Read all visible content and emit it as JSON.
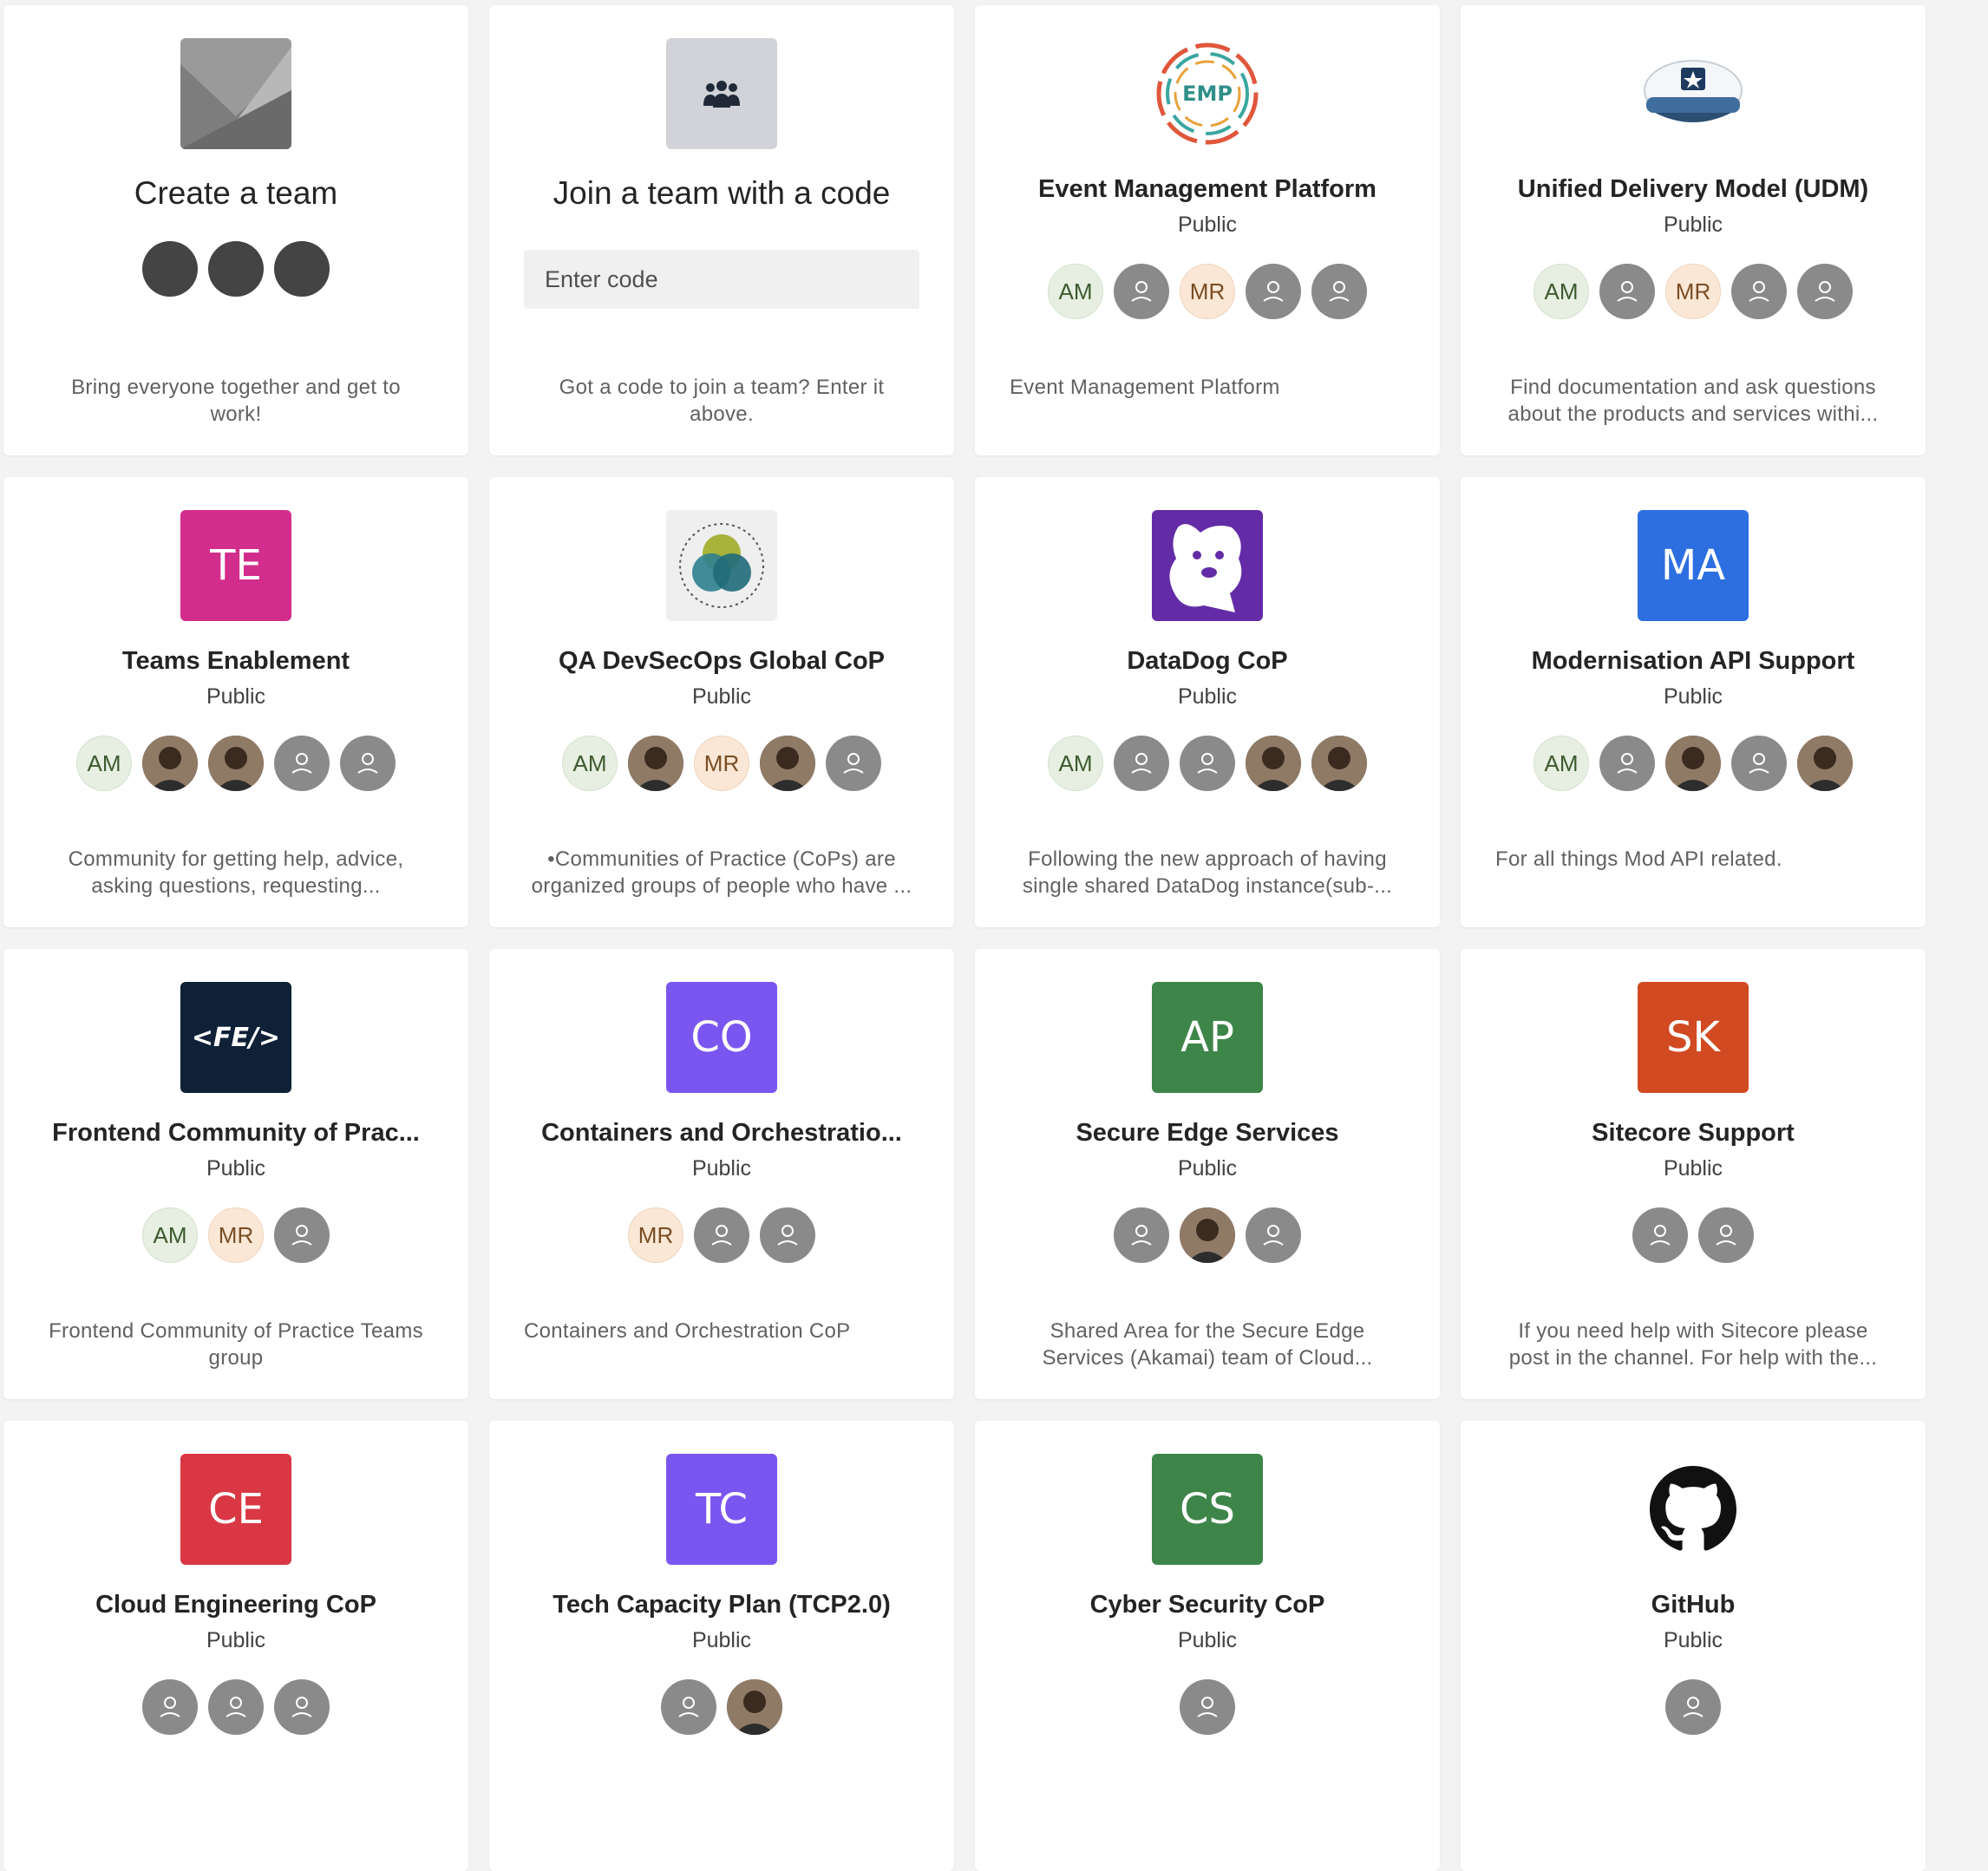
{
  "create_card": {
    "title": "Create a team",
    "description": "Bring everyone together and get to work!"
  },
  "join_card": {
    "title": "Join a team with a code",
    "placeholder": "Enter code",
    "description": "Got a code to join a team? Enter it above."
  },
  "teams": [
    {
      "name": "Event Management Platform",
      "visibility": "Public",
      "logo_type": "emp-logo-icon",
      "logo_text": "EMP",
      "members": [
        "AM",
        "generic",
        "MR",
        "generic",
        "generic"
      ],
      "description": "Event Management Platform",
      "align": "left"
    },
    {
      "name": "Unified Delivery Model (UDM)",
      "visibility": "Public",
      "logo_type": "captain-hat-icon",
      "logo_text": "",
      "members": [
        "AM",
        "generic",
        "MR",
        "generic",
        "generic"
      ],
      "description": "Find documentation and ask questions about the products and services withi...",
      "align": "center"
    },
    {
      "name": "Teams Enablement",
      "visibility": "Public",
      "logo_text": "TE",
      "logo_color": "#d22d8c",
      "members": [
        "AM",
        "photo",
        "photo",
        "generic",
        "generic"
      ],
      "description": "Community for getting help, advice, asking questions, requesting...",
      "align": "center"
    },
    {
      "name": "QA DevSecOps Global CoP",
      "visibility": "Public",
      "logo_type": "venn-diagram-icon",
      "logo_text": "",
      "members": [
        "AM",
        "photo",
        "MR",
        "photo",
        "generic"
      ],
      "description": "•Communities of Practice (CoPs) are organized groups of people who have ...",
      "align": "center"
    },
    {
      "name": "DataDog CoP",
      "visibility": "Public",
      "logo_type": "datadog-icon",
      "logo_text": "",
      "members": [
        "AM",
        "generic",
        "generic",
        "photo",
        "photo"
      ],
      "description": "Following the new approach of having single shared DataDog instance(sub-...",
      "align": "center"
    },
    {
      "name": "Modernisation API Support",
      "visibility": "Public",
      "logo_text": "MA",
      "logo_color": "#2d6fe0",
      "members": [
        "AM",
        "generic",
        "photo",
        "generic",
        "photo"
      ],
      "description": "For all things Mod API related.",
      "align": "left"
    },
    {
      "name": "Frontend Community of Prac...",
      "visibility": "Public",
      "logo_type": "fe-logo-icon",
      "logo_text": "<FE/>",
      "members": [
        "AM",
        "MR",
        "generic"
      ],
      "description": "Frontend Community of Practice Teams group",
      "align": "center"
    },
    {
      "name": "Containers and Orchestratio...",
      "visibility": "Public",
      "logo_text": "CO",
      "logo_color": "#7b55f0",
      "members": [
        "MR",
        "generic",
        "generic"
      ],
      "description": "Containers and Orchestration CoP",
      "align": "left"
    },
    {
      "name": "Secure Edge Services",
      "visibility": "Public",
      "logo_text": "AP",
      "logo_color": "#3e854a",
      "members": [
        "generic",
        "photo",
        "generic"
      ],
      "description": "Shared Area for the Secure Edge Services (Akamai) team of Cloud...",
      "align": "center"
    },
    {
      "name": "Sitecore Support",
      "visibility": "Public",
      "logo_text": "SK",
      "logo_color": "#d14a22",
      "members": [
        "generic",
        "generic"
      ],
      "description": "If you need help with Sitecore please post in the channel. For help with the...",
      "align": "center"
    },
    {
      "name": "Cloud Engineering CoP",
      "visibility": "Public",
      "logo_text": "CE",
      "logo_color": "#d93744",
      "members": [
        "generic",
        "generic",
        "generic"
      ],
      "description": "",
      "align": "center"
    },
    {
      "name": "Tech Capacity Plan (TCP2.0)",
      "visibility": "Public",
      "logo_text": "TC",
      "logo_color": "#7b55f0",
      "members": [
        "generic",
        "photo"
      ],
      "description": "",
      "align": "center"
    },
    {
      "name": "Cyber Security CoP",
      "visibility": "Public",
      "logo_text": "CS",
      "logo_color": "#3e854a",
      "members": [
        "generic"
      ],
      "description": "",
      "align": "center"
    },
    {
      "name": "GitHub",
      "visibility": "Public",
      "logo_type": "github-icon",
      "logo_text": "",
      "members": [
        "generic"
      ],
      "description": "",
      "align": "center"
    }
  ]
}
